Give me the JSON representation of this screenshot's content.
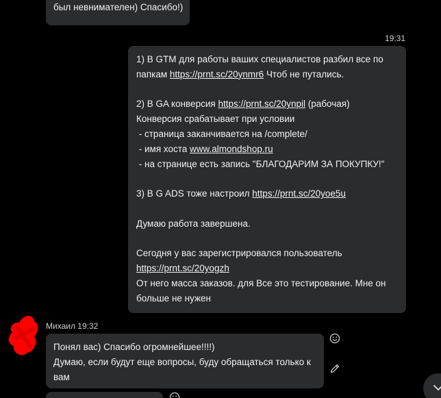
{
  "previous_message": {
    "text": "был невнимателен) Спасибо!)"
  },
  "outgoing_message": {
    "time": "19:31",
    "lines": [
      [
        {
          "t": "1) В GTM для работы ваших специалистов разбил все по"
        }
      ],
      [
        {
          "t": "папкам "
        },
        {
          "t": "https://prnt.sc/20ynmr6",
          "link": true
        },
        {
          "t": " Чтоб не путались."
        }
      ],
      [],
      [
        {
          "t": "2) В GA конверсия "
        },
        {
          "t": "https://prnt.sc/20ynpil",
          "link": true
        },
        {
          "t": " (рабочая)"
        }
      ],
      [
        {
          "t": "Конверсия срабатывает при условии"
        }
      ],
      [
        {
          "t": " - страница заканчивается на /complete/"
        }
      ],
      [
        {
          "t": " - имя хоста "
        },
        {
          "t": "www.almondshop.ru",
          "link": true
        }
      ],
      [
        {
          "t": " - на странице есть запись \"БЛАГОДАРИМ ЗА ПОКУПКУ!\""
        }
      ],
      [],
      [
        {
          "t": "3) В G ADS тоже настроил "
        },
        {
          "t": "https://prnt.sc/20yoe5u",
          "link": true
        }
      ],
      [],
      [
        {
          "t": "Думаю работа завершена."
        }
      ],
      [],
      [
        {
          "t": "Сегодня у вас зарегистрировался пользователь"
        }
      ],
      [
        {
          "t": "https://prnt.sc/20yogzh",
          "link": true
        }
      ],
      [
        {
          "t": "От него масса заказов. для Все это тестирование. Мне он"
        }
      ],
      [
        {
          "t": "больше не нужен"
        }
      ]
    ]
  },
  "incoming_message": {
    "sender": "Михаил",
    "time": "19:32",
    "lines": [
      "Понял вас) Спасибо огромнейшее!!!!)",
      "Думаю, если будут еще вопросы, буду обращаться только к",
      "вам"
    ]
  },
  "icons": {
    "reaction": "smile-icon",
    "edit": "pencil-icon",
    "scroll": "chevron-down-icon",
    "avatar": "redacted-avatar"
  },
  "colors": {
    "background": "#000000",
    "bubble": "#2b2c2e",
    "text": "#f2f2f2",
    "meta_text": "#cfd0d2",
    "redaction": "#ff0000"
  }
}
